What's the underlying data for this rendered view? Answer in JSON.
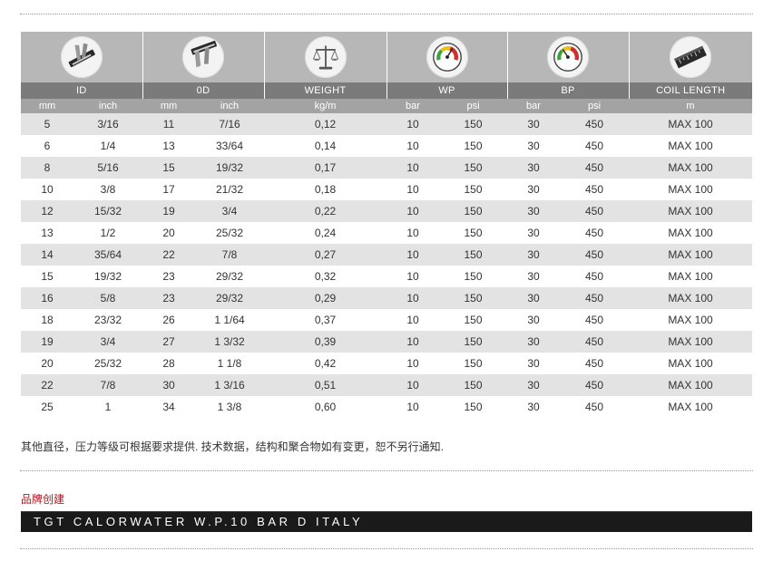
{
  "columns": {
    "id": "ID",
    "od": "0D",
    "weight": "WEIGHT",
    "wp": "WP",
    "bp": "BP",
    "coil": "COIL LENGTH"
  },
  "units": {
    "id_mm": "mm",
    "id_inch": "inch",
    "od_mm": "mm",
    "od_inch": "inch",
    "weight": "kg/m",
    "wp_bar": "bar",
    "wp_psi": "psi",
    "bp_bar": "bar",
    "bp_psi": "psi",
    "coil": "m"
  },
  "icons": {
    "id": "caliper-icon",
    "od": "caliper-icon",
    "weight": "scale-icon",
    "wp": "pressure-gauge-icon",
    "bp": "pressure-gauge-icon",
    "coil": "measuring-tape-icon"
  },
  "rows": [
    [
      "5",
      "3/16",
      "11",
      "7/16",
      "0,12",
      "10",
      "150",
      "30",
      "450",
      "MAX 100"
    ],
    [
      "6",
      "1/4",
      "13",
      "33/64",
      "0,14",
      "10",
      "150",
      "30",
      "450",
      "MAX 100"
    ],
    [
      "8",
      "5/16",
      "15",
      "19/32",
      "0,17",
      "10",
      "150",
      "30",
      "450",
      "MAX 100"
    ],
    [
      "10",
      "3/8",
      "17",
      "21/32",
      "0,18",
      "10",
      "150",
      "30",
      "450",
      "MAX 100"
    ],
    [
      "12",
      "15/32",
      "19",
      "3/4",
      "0,22",
      "10",
      "150",
      "30",
      "450",
      "MAX 100"
    ],
    [
      "13",
      "1/2",
      "20",
      "25/32",
      "0,24",
      "10",
      "150",
      "30",
      "450",
      "MAX 100"
    ],
    [
      "14",
      "35/64",
      "22",
      "7/8",
      "0,27",
      "10",
      "150",
      "30",
      "450",
      "MAX 100"
    ],
    [
      "15",
      "19/32",
      "23",
      "29/32",
      "0,32",
      "10",
      "150",
      "30",
      "450",
      "MAX 100"
    ],
    [
      "16",
      "5/8",
      "23",
      "29/32",
      "0,29",
      "10",
      "150",
      "30",
      "450",
      "MAX 100"
    ],
    [
      "18",
      "23/32",
      "26",
      "1 1/64",
      "0,37",
      "10",
      "150",
      "30",
      "450",
      "MAX 100"
    ],
    [
      "19",
      "3/4",
      "27",
      "1 3/32",
      "0,39",
      "10",
      "150",
      "30",
      "450",
      "MAX 100"
    ],
    [
      "20",
      "25/32",
      "28",
      "1 1/8",
      "0,42",
      "10",
      "150",
      "30",
      "450",
      "MAX 100"
    ],
    [
      "22",
      "7/8",
      "30",
      "1 3/16",
      "0,51",
      "10",
      "150",
      "30",
      "450",
      "MAX 100"
    ],
    [
      "25",
      "1",
      "34",
      "1 3/8",
      "0,60",
      "10",
      "150",
      "30",
      "450",
      "MAX 100"
    ]
  ],
  "note": "其他直径，压力等级可根据要求提供. 技术数据，结构和聚合物如有变更，恕不另行通知.",
  "brand": {
    "label": "品牌创建",
    "name": "TGT CALORWATER W.P.10 BAR D ITALY"
  },
  "colors": {
    "icon_row_bg": "#b7b7b7",
    "title_row_bg": "#7b7b7b",
    "unit_row_bg": "#a3a3a3",
    "stripe_bg": "#e3e3e3",
    "brand_label": "#b0141e",
    "brand_bar_bg": "#1a1a1a"
  }
}
